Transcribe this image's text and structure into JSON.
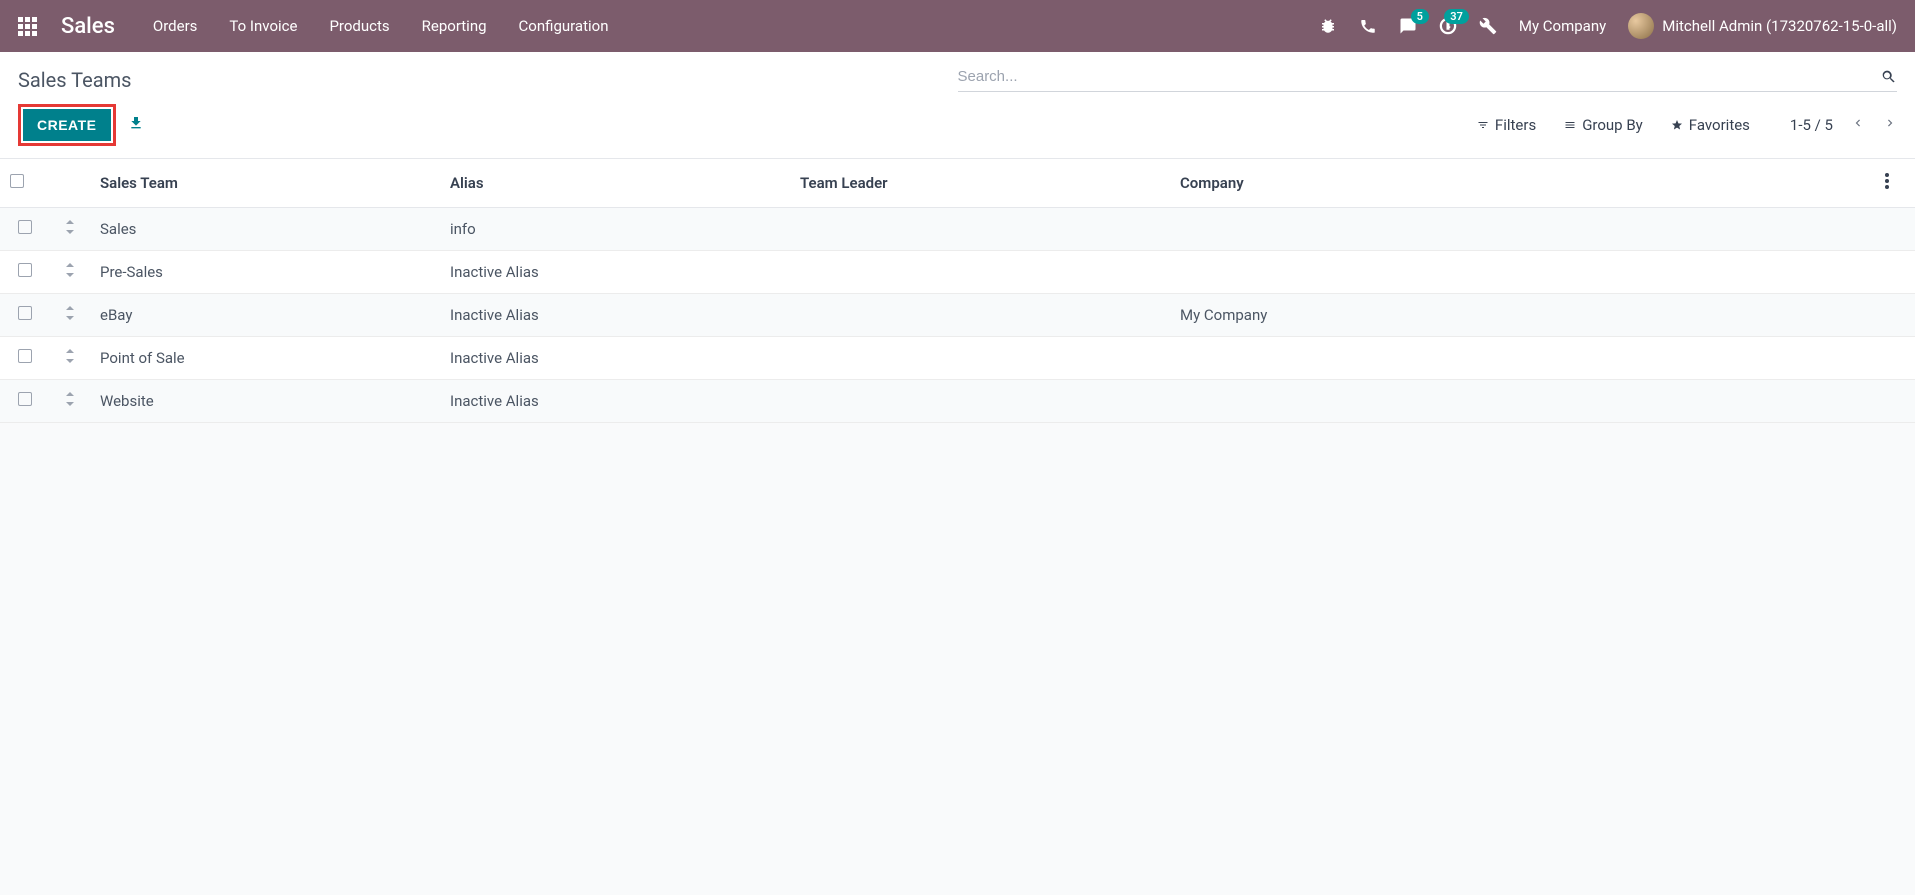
{
  "topbar": {
    "brand": "Sales",
    "nav": [
      "Orders",
      "To Invoice",
      "Products",
      "Reporting",
      "Configuration"
    ],
    "messages_badge": "5",
    "activities_badge": "37",
    "company": "My Company",
    "user_name": "Mitchell Admin (17320762-15-0-all)"
  },
  "control_panel": {
    "title": "Sales Teams",
    "search_placeholder": "Search...",
    "create_label": "CREATE",
    "filters_label": "Filters",
    "groupby_label": "Group By",
    "favorites_label": "Favorites",
    "pager": "1-5 / 5"
  },
  "table": {
    "headers": {
      "sales_team": "Sales Team",
      "alias": "Alias",
      "team_leader": "Team Leader",
      "company": "Company"
    },
    "rows": [
      {
        "sales_team": "Sales",
        "alias": "info",
        "team_leader": "",
        "company": ""
      },
      {
        "sales_team": "Pre-Sales",
        "alias": "Inactive Alias",
        "team_leader": "",
        "company": ""
      },
      {
        "sales_team": "eBay",
        "alias": "Inactive Alias",
        "team_leader": "",
        "company": "My Company"
      },
      {
        "sales_team": "Point of Sale",
        "alias": "Inactive Alias",
        "team_leader": "",
        "company": ""
      },
      {
        "sales_team": "Website",
        "alias": "Inactive Alias",
        "team_leader": "",
        "company": ""
      }
    ]
  }
}
